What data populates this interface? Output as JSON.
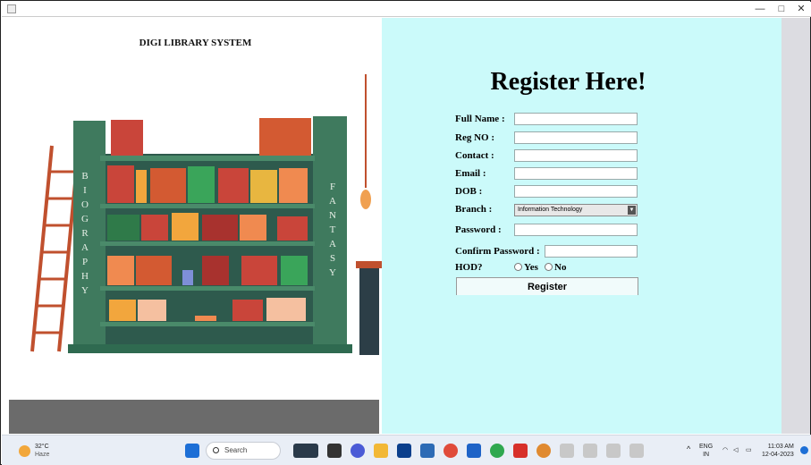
{
  "window": {
    "minimize": "—",
    "maximize": "□",
    "close": "✕"
  },
  "left_panel": {
    "title": "DIGI LIBRARY SYSTEM",
    "shelf_signs": {
      "left": "BIOGRAPHY",
      "right": "FANTASY"
    }
  },
  "form": {
    "heading": "Register Here!",
    "fields": [
      {
        "label": "Full Name :",
        "value": ""
      },
      {
        "label": "Reg NO :",
        "value": ""
      },
      {
        "label": "Contact :",
        "value": ""
      },
      {
        "label": "Email :",
        "value": ""
      },
      {
        "label": "DOB :",
        "value": ""
      }
    ],
    "branch_label": "Branch :",
    "branch_value": "Information Technology",
    "password_label": "Password :",
    "confirm_label": "Confirm Password :",
    "hod_label": "HOD?",
    "hod_yes": "Yes",
    "hod_no": "No",
    "register_button": "Register"
  },
  "taskbar": {
    "weather_temp": "32°C",
    "weather_desc": "Haze",
    "search_placeholder": "Search",
    "lang_top": "ENG",
    "lang_bottom": "IN",
    "time": "11:03 AM",
    "date": "12-04-2023"
  }
}
